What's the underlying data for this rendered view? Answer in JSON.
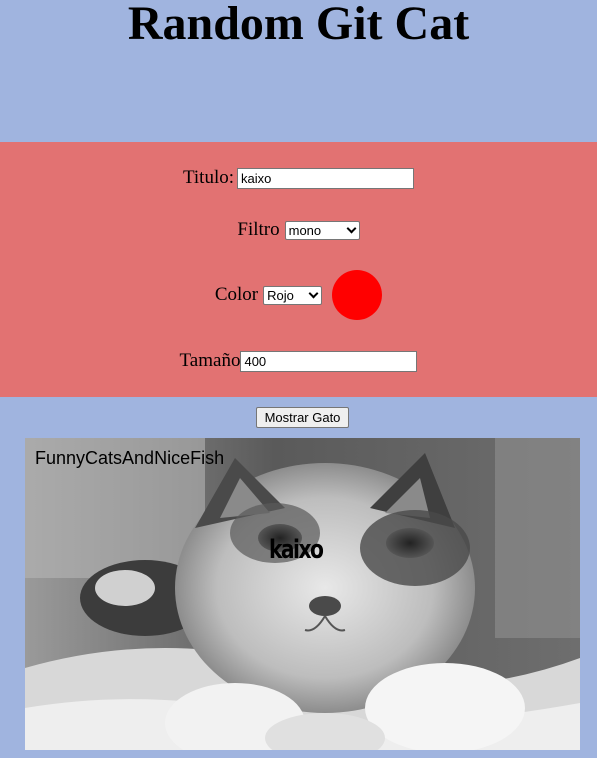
{
  "page": {
    "title": "Random Git Cat"
  },
  "form": {
    "titulo": {
      "label": "Titulo:",
      "value": "kaixo"
    },
    "filtro": {
      "label": "Filtro",
      "selected": "mono"
    },
    "color": {
      "label": "Color",
      "selected": "Rojo",
      "swatch": "#ff0000"
    },
    "tamano": {
      "label": "Tamaño",
      "value": "400"
    }
  },
  "actions": {
    "show_label": "Mostrar Gato"
  },
  "cat_image": {
    "brand": "FunnyCatsAndNiceFish",
    "caption": "kaixo"
  },
  "colors": {
    "background": "#a0b4df",
    "panel": "#e27272"
  }
}
